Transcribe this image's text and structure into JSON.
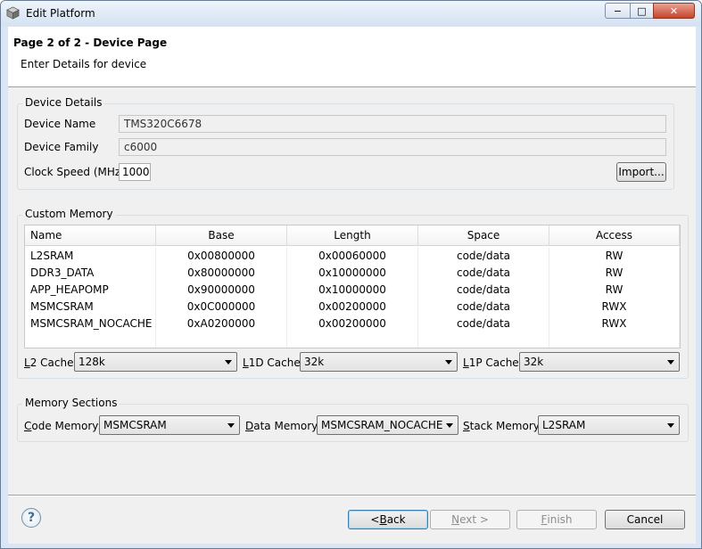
{
  "window": {
    "title": "Edit Platform",
    "min_glyph": "−",
    "max_glyph": "□",
    "close_glyph": "✕"
  },
  "header": {
    "title": "Page 2 of 2 - Device Page",
    "subtitle": "Enter Details for device"
  },
  "device_details": {
    "legend": "Device Details",
    "name_label": "Device Name",
    "name_value": "TMS320C6678",
    "family_label": "Device Family",
    "family_value": "c6000",
    "clock_label": "Clock Speed (MHz)",
    "clock_value": "1000",
    "import_label": "Import..."
  },
  "custom_memory": {
    "legend": "Custom Memory",
    "columns": [
      "Name",
      "Base",
      "Length",
      "Space",
      "Access"
    ],
    "rows": [
      [
        "L2SRAM",
        "0x00800000",
        "0x00060000",
        "code/data",
        "RW"
      ],
      [
        "DDR3_DATA",
        "0x80000000",
        "0x10000000",
        "code/data",
        "RW"
      ],
      [
        "APP_HEAPOMP",
        "0x90000000",
        "0x10000000",
        "code/data",
        "RW"
      ],
      [
        "MSMCSRAM",
        "0x0C000000",
        "0x00200000",
        "code/data",
        "RWX"
      ],
      [
        "MSMCSRAM_NOCACHE",
        "0xA0200000",
        "0x00200000",
        "code/data",
        "RWX"
      ]
    ],
    "l2_cache": {
      "mnemonic": "L",
      "label_rest": "2 Cache:",
      "value": "128k"
    },
    "l1d_cache": {
      "mnemonic": "L",
      "label_rest": "1D Cache:",
      "value": "32k"
    },
    "l1p_cache": {
      "mnemonic": "L",
      "label_rest": "1P Cache:",
      "value": "32k"
    }
  },
  "memory_sections": {
    "legend": "Memory Sections",
    "code": {
      "mnemonic": "C",
      "label_rest": "ode Memory:",
      "value": "MSMCSRAM"
    },
    "data": {
      "mnemonic": "D",
      "label_rest": "ata Memory:",
      "value": "MSMCSRAM_NOCACHE"
    },
    "stack": {
      "mnemonic": "S",
      "label_rest": "tack Memory:",
      "value": "L2SRAM"
    }
  },
  "footer": {
    "help_glyph": "?",
    "back_prefix": "< ",
    "back_mnemonic": "B",
    "back_rest": "ack",
    "next_mnemonic": "N",
    "next_rest": "ext >",
    "finish_mnemonic": "F",
    "finish_rest": "inish",
    "cancel_label": "Cancel"
  }
}
